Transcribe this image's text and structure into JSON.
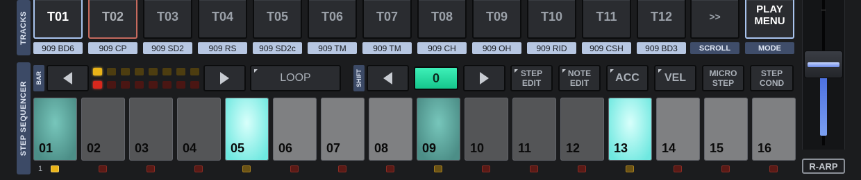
{
  "sections": {
    "tracks": "TRACKS",
    "step_sequencer": "STEP SEQUENCER"
  },
  "tracks": [
    {
      "id": "T01",
      "name": "909 BD6"
    },
    {
      "id": "T02",
      "name": "909 CP"
    },
    {
      "id": "T03",
      "name": "909 SD2"
    },
    {
      "id": "T04",
      "name": "909 RS"
    },
    {
      "id": "T05",
      "name": "909 SD2c"
    },
    {
      "id": "T06",
      "name": "909 TM"
    },
    {
      "id": "T07",
      "name": "909 TM"
    },
    {
      "id": "T08",
      "name": "909 CH"
    },
    {
      "id": "T09",
      "name": "909 OH"
    },
    {
      "id": "T10",
      "name": "909 RID"
    },
    {
      "id": "T11",
      "name": "909 CSH"
    },
    {
      "id": "T12",
      "name": "909 BD3"
    }
  ],
  "scroll": {
    "label": ">>",
    "caption": "SCROLL"
  },
  "play_menu": {
    "line1": "PLAY",
    "line2": "MENU",
    "caption": "MODE"
  },
  "bar_label": "BAR",
  "loop_label": "LOOP",
  "shift_label": "SHIFT",
  "shift_value": "0",
  "buttons": {
    "step_edit": {
      "line1": "STEP",
      "line2": "EDIT"
    },
    "note_edit": {
      "line1": "NOTE",
      "line2": "EDIT"
    },
    "acc": "ACC",
    "vel": "VEL",
    "micro_step": {
      "line1": "MICRO",
      "line2": "STEP"
    },
    "step_cond": {
      "line1": "STEP",
      "line2": "COND"
    }
  },
  "pads": [
    "01",
    "02",
    "03",
    "04",
    "05",
    "06",
    "07",
    "08",
    "09",
    "10",
    "11",
    "12",
    "13",
    "14",
    "15",
    "16"
  ],
  "pad_states": [
    "teal",
    "off",
    "off",
    "off",
    "on",
    "bar",
    "bar",
    "bar",
    "teal",
    "off",
    "off",
    "off",
    "on",
    "bar",
    "bar",
    "bar"
  ],
  "bar_indicator": "1",
  "rarp_label": "R-ARP",
  "colors": {
    "accent_green": "#22d49a",
    "selected_outline": "#a9c4ee",
    "cp_outline": "#c56a5e",
    "pad_on": "#6ee8e0",
    "label_bg": "#b7c7e2"
  }
}
